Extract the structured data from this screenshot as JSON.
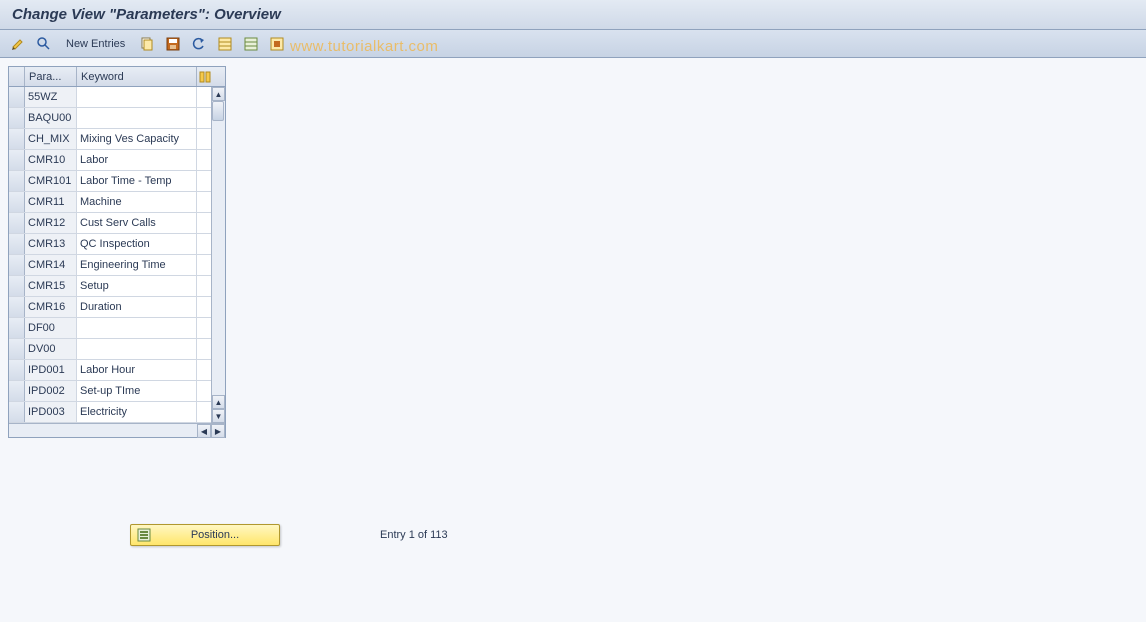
{
  "title": "Change View \"Parameters\": Overview",
  "toolbar": {
    "new_entries_label": "New Entries"
  },
  "watermark": "www.tutorialkart.com",
  "grid": {
    "col1_header": "Para...",
    "col2_header": "Keyword",
    "rows": [
      {
        "param": "55WZ",
        "keyword": ""
      },
      {
        "param": "BAQU00",
        "keyword": ""
      },
      {
        "param": "CH_MIX",
        "keyword": "Mixing Ves Capacity"
      },
      {
        "param": "CMR10",
        "keyword": "Labor"
      },
      {
        "param": "CMR101",
        "keyword": "Labor Time - Temp"
      },
      {
        "param": "CMR11",
        "keyword": "Machine"
      },
      {
        "param": "CMR12",
        "keyword": "Cust Serv Calls"
      },
      {
        "param": "CMR13",
        "keyword": "QC Inspection"
      },
      {
        "param": "CMR14",
        "keyword": "Engineering Time"
      },
      {
        "param": "CMR15",
        "keyword": "Setup"
      },
      {
        "param": "CMR16",
        "keyword": "Duration"
      },
      {
        "param": "DF00",
        "keyword": ""
      },
      {
        "param": "DV00",
        "keyword": ""
      },
      {
        "param": "IPD001",
        "keyword": "Labor Hour"
      },
      {
        "param": "IPD002",
        "keyword": "Set-up TIme"
      },
      {
        "param": "IPD003",
        "keyword": "Electricity"
      }
    ]
  },
  "footer": {
    "position_label": "Position...",
    "status": "Entry 1 of 113"
  }
}
